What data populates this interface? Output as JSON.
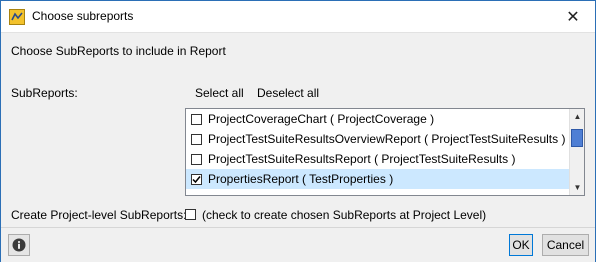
{
  "window": {
    "title": "Choose subreports",
    "close_glyph": "✕"
  },
  "header": {
    "text": "Choose SubReports to include in Report"
  },
  "subreports": {
    "label": "SubReports:",
    "select_all": "Select all",
    "deselect_all": "Deselect all",
    "items": [
      {
        "label": "ProjectCoverageChart ( ProjectCoverage )",
        "checked": false,
        "selected": false
      },
      {
        "label": "ProjectTestSuiteResultsOverviewReport ( ProjectTestSuiteResults )",
        "checked": false,
        "selected": false
      },
      {
        "label": "ProjectTestSuiteResultsReport ( ProjectTestSuiteResults )",
        "checked": false,
        "selected": false
      },
      {
        "label": "PropertiesReport ( TestProperties )",
        "checked": true,
        "selected": true
      }
    ]
  },
  "project_level": {
    "label": "Create Project-level SubReports:",
    "checked": false,
    "hint": "(check to create chosen SubReports at Project Level)"
  },
  "footer": {
    "info_icon": "info-icon",
    "ok_label": "OK",
    "cancel_label": "Cancel"
  },
  "colors": {
    "selection": "#cce8ff",
    "dialog_bg": "#f0f0f0",
    "accent": "#0078d7"
  }
}
